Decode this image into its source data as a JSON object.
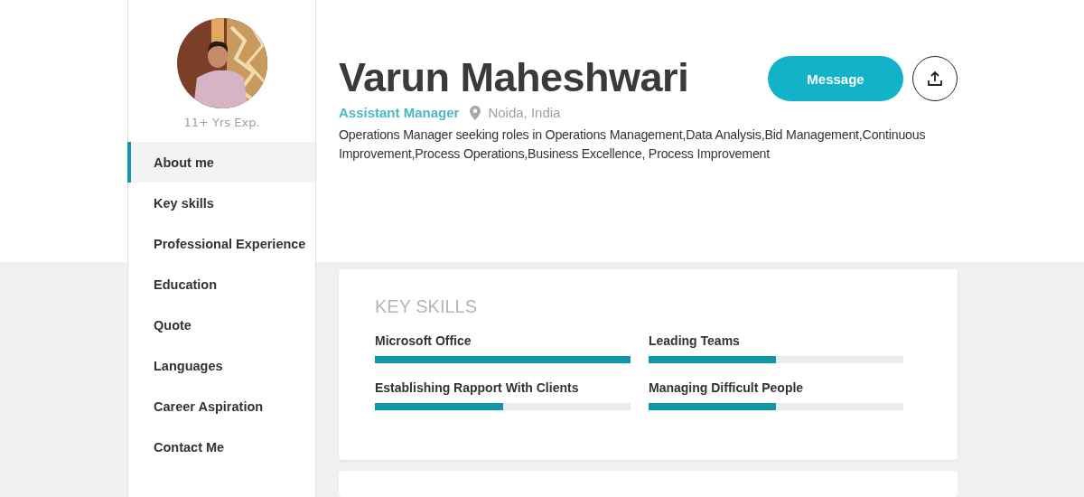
{
  "sidebar": {
    "experience": "11+ Yrs Exp.",
    "items": [
      {
        "label": "About me",
        "selected": true
      },
      {
        "label": "Key skills",
        "selected": false
      },
      {
        "label": "Professional Experience",
        "selected": false
      },
      {
        "label": "Education",
        "selected": false
      },
      {
        "label": "Quote",
        "selected": false
      },
      {
        "label": "Languages",
        "selected": false
      },
      {
        "label": "Career Aspiration",
        "selected": false
      },
      {
        "label": "Contact Me",
        "selected": false
      }
    ]
  },
  "profile": {
    "name": "Varun Maheshwari",
    "designation": "Assistant Manager",
    "location": "Noida, India",
    "summary": "Operations Manager seeking roles in Operations Management,Data Analysis,Bid Management,Continuous Improvement,Process Operations,Business Excellence, Process Improvement",
    "message_button": "Message"
  },
  "key_skills": {
    "title": "KEY SKILLS",
    "skills": [
      {
        "name": "Microsoft Office",
        "level": 1.0
      },
      {
        "name": "Leading Teams",
        "level": 0.5
      },
      {
        "name": "Establishing Rapport With Clients",
        "level": 0.5
      },
      {
        "name": "Managing Difficult People",
        "level": 0.5
      }
    ]
  }
}
